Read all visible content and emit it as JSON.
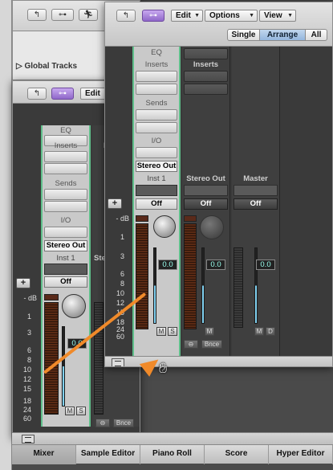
{
  "bg_window": {
    "section_label": "▷ Global Tracks"
  },
  "front_window": {
    "toolbar": {
      "edit": "Edit",
      "options": "Options",
      "view": "View",
      "segments": [
        "Single",
        "Arrange",
        "All"
      ],
      "active_segment": "Arrange"
    },
    "strip1": {
      "eq": "EQ",
      "inserts": "Inserts",
      "sends": "Sends",
      "io": "I/O",
      "output": "Stereo Out",
      "name": "Inst 1",
      "off": "Off",
      "fader_value": "0.0",
      "m": "M",
      "s": "S"
    },
    "strip2": {
      "inserts": "Inserts",
      "name": "Stereo Out",
      "off": "Off",
      "fader_value": "0.0",
      "m": "M",
      "bounce": "Bnce"
    },
    "strip3": {
      "name": "Master",
      "off": "Off",
      "fader_value": "0.0",
      "m": "M",
      "d": "D"
    },
    "scale": [
      "- dB",
      "1",
      "3",
      "6",
      "8",
      "10",
      "12",
      "15",
      "18",
      "24",
      "60"
    ],
    "plus": "+"
  },
  "middle_window": {
    "toolbar": {
      "edit": "Edit"
    },
    "strip1": {
      "eq": "EQ",
      "inserts": "Inserts",
      "sends": "Sends",
      "io": "I/O",
      "output": "Stereo Out",
      "name": "Inst 1",
      "off": "Off",
      "fader_value": "0.0",
      "m": "M",
      "s": "S"
    },
    "strip2": {
      "io_partial": "I",
      "name_partial": "Ste",
      "m": "M",
      "d": "D",
      "bounce": "Bnce"
    },
    "scale": [
      "- dB",
      "1",
      "3",
      "6",
      "8",
      "10",
      "12",
      "15",
      "18",
      "24",
      "60"
    ],
    "plus": "+"
  },
  "tabs": [
    "Mixer",
    "Sample Editor",
    "Piano Roll",
    "Score",
    "Hyper Editor"
  ],
  "active_tab": "Mixer",
  "colors": {
    "accent_purple": "#8f68c9",
    "select_green": "#5fbf8a",
    "arrow_orange": "#f08a2a",
    "fader_blue": "#7fd0f0"
  },
  "icons": [
    "back-arrow-icon",
    "link-icon",
    "running-man-icon",
    "hand-cursor-icon",
    "grid-icon"
  ]
}
